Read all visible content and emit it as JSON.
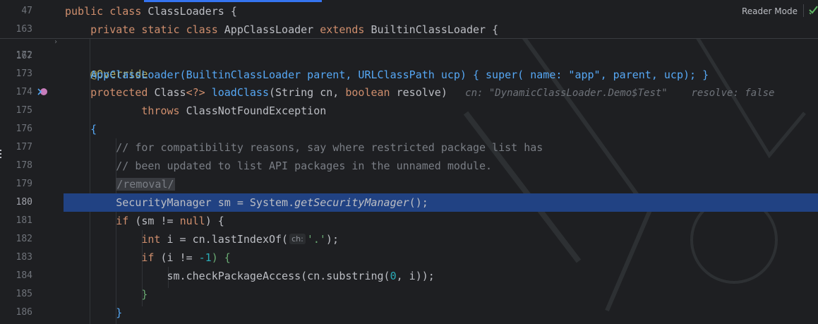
{
  "toolbar": {
    "reader_mode_label": "Reader Mode"
  },
  "sticky": [
    {
      "num": "47",
      "parts": [
        {
          "t": "public ",
          "c": "kw"
        },
        {
          "t": "class ",
          "c": "kw"
        },
        {
          "t": "ClassLoaders ",
          "c": "ty"
        },
        {
          "t": "{",
          "c": "ty"
        }
      ]
    },
    {
      "num": "163",
      "parts": [
        {
          "t": "    private ",
          "c": "kw"
        },
        {
          "t": "static ",
          "c": "kw"
        },
        {
          "t": "class ",
          "c": "kw"
        },
        {
          "t": "AppClassLoader ",
          "c": "ty"
        },
        {
          "t": "extends ",
          "c": "kw"
        },
        {
          "t": "BuiltinClassLoader ",
          "c": "ty"
        },
        {
          "t": "{",
          "c": "ty"
        }
      ]
    }
  ],
  "partial_line": {
    "num": "167",
    "text": "    AppClassLoader(BuiltinClassLoader parent, URLClassPath ucp) { super( name: \"app\", parent, ucp); }"
  },
  "lines": [
    {
      "num": "172",
      "parts": []
    },
    {
      "num": "173",
      "parts": [
        {
          "t": "    @Override",
          "c": "an"
        }
      ]
    },
    {
      "num": "174",
      "parts": [
        {
          "t": "    protected ",
          "c": "kw"
        },
        {
          "t": "Class",
          "c": "ty"
        },
        {
          "t": "<?> ",
          "c": "kw"
        },
        {
          "t": "loadClass",
          "c": "fn"
        },
        {
          "t": "(String cn, ",
          "c": "ty"
        },
        {
          "t": "boolean ",
          "c": "kw"
        },
        {
          "t": "resolve)",
          "c": "ty"
        },
        {
          "t": "   cn: \"DynamicClassLoader.Demo$Test\"    resolve: false",
          "c": "hint"
        }
      ]
    },
    {
      "num": "175",
      "parts": [
        {
          "t": "            throws ",
          "c": "kw"
        },
        {
          "t": "ClassNotFoundException",
          "c": "ty"
        }
      ]
    },
    {
      "num": "176",
      "parts": [
        {
          "t": "    {",
          "c": "fn"
        }
      ]
    },
    {
      "num": "177",
      "parts": [
        {
          "t": "        // for compatibility reasons, say where restricted package list has",
          "c": "cm"
        }
      ]
    },
    {
      "num": "178",
      "parts": [
        {
          "t": "        // been updated to list API packages in the unnamed module.",
          "c": "cm"
        }
      ]
    },
    {
      "num": "179",
      "parts": [
        {
          "t": "        ",
          "c": "ty"
        },
        {
          "t": "/removal/",
          "c": "removal"
        }
      ]
    },
    {
      "num": "180",
      "parts": [
        {
          "t": "        SecurityManager sm = System.",
          "c": "ty"
        },
        {
          "t": "getSecurityManager",
          "c": "it"
        },
        {
          "t": "();",
          "c": "ty"
        }
      ]
    },
    {
      "num": "181",
      "parts": [
        {
          "t": "        ",
          "c": "ty"
        },
        {
          "t": "if ",
          "c": "kw"
        },
        {
          "t": "(sm != ",
          "c": "ty"
        },
        {
          "t": "null",
          "c": "kw"
        },
        {
          "t": ") {",
          "c": "ty"
        }
      ]
    },
    {
      "num": "182",
      "parts": [
        {
          "t": "            ",
          "c": "ty"
        },
        {
          "t": "int ",
          "c": "kw"
        },
        {
          "t": "i = cn.lastIndexOf(",
          "c": "ty"
        },
        {
          "t": "ch:",
          "c": "pill"
        },
        {
          "t": "'.'",
          "c": "st"
        },
        {
          "t": ");",
          "c": "ty"
        }
      ]
    },
    {
      "num": "183",
      "parts": [
        {
          "t": "            ",
          "c": "ty"
        },
        {
          "t": "if ",
          "c": "kw"
        },
        {
          "t": "(i != ",
          "c": "ty"
        },
        {
          "t": "-1",
          "c": "nm"
        },
        {
          "t": ") {",
          "c": "st"
        }
      ]
    },
    {
      "num": "184",
      "parts": [
        {
          "t": "                sm.checkPackageAccess(cn.substring(",
          "c": "ty"
        },
        {
          "t": "0",
          "c": "nm"
        },
        {
          "t": ", i));",
          "c": "ty"
        }
      ]
    },
    {
      "num": "185",
      "parts": [
        {
          "t": "            }",
          "c": "st"
        }
      ]
    },
    {
      "num": "186",
      "parts": [
        {
          "t": "        }",
          "c": "fn"
        }
      ]
    }
  ],
  "current_line": "180",
  "colors": {
    "background": "#1e1f22",
    "selection": "#214283",
    "accent": "#3574f0"
  }
}
